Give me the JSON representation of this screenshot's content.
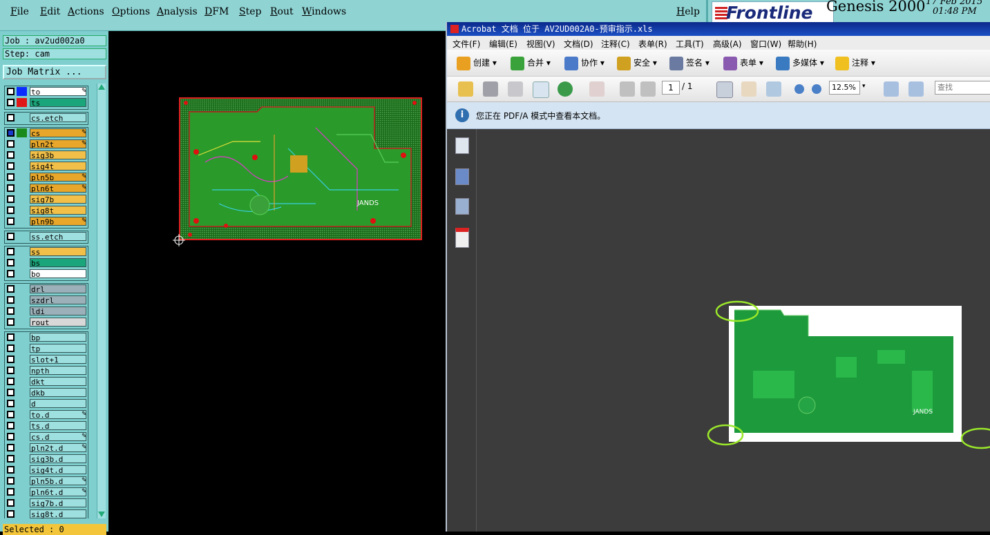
{
  "genesis": {
    "menu": [
      "File",
      "Edit",
      "Actions",
      "Options",
      "Analysis",
      "DFM",
      "Step",
      "Rout",
      "Windows"
    ],
    "help": "Help",
    "brand": "Frontline",
    "title": "Genesis 2000",
    "date": "17 Feb 2015",
    "time": "01:48 PM",
    "job": "Job : av2ud002a0",
    "step": "Step: cam",
    "job_matrix": "Job Matrix ...",
    "selected": "Selected : 0",
    "layer_groups": [
      [
        {
          "name": "to",
          "color": "#0a2cff",
          "bg": "#ffffff",
          "pen": true
        },
        {
          "name": "ts",
          "color": "#e01818",
          "bg": "#1aa67a",
          "pen": false
        }
      ],
      [
        {
          "name": "cs.etch",
          "color": "",
          "bg": "#9ee0e0",
          "pen": false
        }
      ],
      [
        {
          "name": "cs",
          "color": "#1a8a1a",
          "bg": "#e8a72a",
          "pen": true,
          "sel": true
        },
        {
          "name": "pln2t",
          "color": "",
          "bg": "#e8a72a",
          "pen": true
        },
        {
          "name": "sig3b",
          "color": "",
          "bg": "#f2c048",
          "pen": false
        },
        {
          "name": "sig4t",
          "color": "",
          "bg": "#f2c048",
          "pen": false
        },
        {
          "name": "pln5b",
          "color": "",
          "bg": "#e8a72a",
          "pen": true
        },
        {
          "name": "pln6t",
          "color": "",
          "bg": "#e8a72a",
          "pen": true
        },
        {
          "name": "sig7b",
          "color": "",
          "bg": "#f2c048",
          "pen": false
        },
        {
          "name": "sig8t",
          "color": "",
          "bg": "#f2c048",
          "pen": false
        },
        {
          "name": "pln9b",
          "color": "",
          "bg": "#e8a72a",
          "pen": true
        }
      ],
      [
        {
          "name": "ss.etch",
          "color": "",
          "bg": "#9ee0e0",
          "pen": false
        }
      ],
      [
        {
          "name": "ss",
          "color": "",
          "bg": "#f2c048",
          "pen": false
        },
        {
          "name": "bs",
          "color": "",
          "bg": "#1aa67a",
          "pen": false
        },
        {
          "name": "bo",
          "color": "",
          "bg": "#ffffff",
          "pen": false
        }
      ],
      [
        {
          "name": "drl",
          "color": "",
          "bg": "#9bb0b8",
          "pen": false
        },
        {
          "name": "szdrl",
          "color": "",
          "bg": "#9bb0b8",
          "pen": false
        },
        {
          "name": "ldi",
          "color": "",
          "bg": "#9bb0b8",
          "pen": false
        },
        {
          "name": "rout",
          "color": "",
          "bg": "#d8d8d8",
          "pen": false
        }
      ],
      [
        {
          "name": "bp",
          "color": "",
          "bg": "#9ee0e0",
          "pen": false
        },
        {
          "name": "tp",
          "color": "",
          "bg": "#9ee0e0",
          "pen": false
        },
        {
          "name": "slot+1",
          "color": "",
          "bg": "#9ee0e0",
          "pen": false
        },
        {
          "name": "npth",
          "color": "",
          "bg": "#9ee0e0",
          "pen": false
        },
        {
          "name": "dkt",
          "color": "",
          "bg": "#9ee0e0",
          "pen": false
        },
        {
          "name": "dkb",
          "color": "",
          "bg": "#9ee0e0",
          "pen": false
        },
        {
          "name": "d",
          "color": "",
          "bg": "#9ee0e0",
          "pen": false
        },
        {
          "name": "to.d",
          "color": "",
          "bg": "#9ee0e0",
          "pen": true
        },
        {
          "name": "ts.d",
          "color": "",
          "bg": "#9ee0e0",
          "pen": false
        },
        {
          "name": "cs.d",
          "color": "",
          "bg": "#9ee0e0",
          "pen": true
        },
        {
          "name": "pln2t.d",
          "color": "",
          "bg": "#9ee0e0",
          "pen": true
        },
        {
          "name": "sig3b.d",
          "color": "",
          "bg": "#9ee0e0",
          "pen": false
        },
        {
          "name": "sig4t.d",
          "color": "",
          "bg": "#9ee0e0",
          "pen": false
        },
        {
          "name": "pln5b.d",
          "color": "",
          "bg": "#9ee0e0",
          "pen": true
        },
        {
          "name": "pln6t.d",
          "color": "",
          "bg": "#9ee0e0",
          "pen": true
        },
        {
          "name": "sig7b.d",
          "color": "",
          "bg": "#9ee0e0",
          "pen": false
        },
        {
          "name": "sig8t.d",
          "color": "",
          "bg": "#9ee0e0",
          "pen": false
        }
      ]
    ]
  },
  "acrobat": {
    "title": "Acrobat 文档 位于 AV2UD002A0-预审指示.xls",
    "menu": [
      "文件(F)",
      "编辑(E)",
      "视图(V)",
      "文档(D)",
      "注释(C)",
      "表单(R)",
      "工具(T)",
      "高级(A)",
      "窗口(W)",
      "帮助(H)"
    ],
    "toolbar": [
      {
        "label": "创建",
        "icon_color": "#e9a020"
      },
      {
        "label": "合并",
        "icon_color": "#3aa23a"
      },
      {
        "label": "协作",
        "icon_color": "#4a7ac8"
      },
      {
        "label": "安全",
        "icon_color": "#d0a020"
      },
      {
        "label": "签名",
        "icon_color": "#6a7aa0"
      },
      {
        "label": "表单",
        "icon_color": "#8a5ab0"
      },
      {
        "label": "多媒体",
        "icon_color": "#3a7ac0"
      },
      {
        "label": "注释",
        "icon_color": "#f0c020"
      }
    ],
    "page_current": "1",
    "page_total": "/ 1",
    "zoom": "12.5%",
    "find_placeholder": "查找",
    "info_icon": "i",
    "info": "您正在 PDF/A 模式中查看本文档。",
    "board_text": "JANDS"
  }
}
